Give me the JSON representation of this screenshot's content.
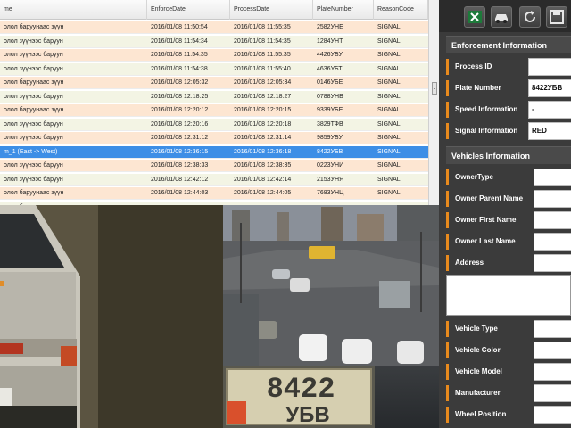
{
  "table": {
    "columns": [
      {
        "label": "me"
      },
      {
        "label": "EnforceDate"
      },
      {
        "label": "ProcessDate"
      },
      {
        "label": "PlateNumber"
      },
      {
        "label": "ReasonCode"
      }
    ],
    "rows": [
      {
        "name": "олол баруунаас зүүн",
        "enforce": "2016/01/08 11:50:54",
        "process": "2016/01/08 11:55:35",
        "plate": "2582УНЕ",
        "reason": "SIGNAL"
      },
      {
        "name": "олол зүүнээс баруун",
        "enforce": "2016/01/08 11:54:34",
        "process": "2016/01/08 11:54:35",
        "plate": "1284УНТ",
        "reason": "SIGNAL"
      },
      {
        "name": "олол зүүнээс баруун",
        "enforce": "2016/01/08 11:54:35",
        "process": "2016/01/08 11:55:35",
        "plate": "4426УБУ",
        "reason": "SIGNAL"
      },
      {
        "name": "олол зүүнээс баруун",
        "enforce": "2016/01/08 11:54:38",
        "process": "2016/01/08 11:55:40",
        "plate": "4636УБТ",
        "reason": "SIGNAL"
      },
      {
        "name": "олол баруунаас зүүн",
        "enforce": "2016/01/08 12:05:32",
        "process": "2016/01/08 12:05:34",
        "plate": "0146УБЕ",
        "reason": "SIGNAL"
      },
      {
        "name": "олол зүүнээс баруун",
        "enforce": "2016/01/08 12:18:25",
        "process": "2016/01/08 12:18:27",
        "plate": "0788УНВ",
        "reason": "SIGNAL"
      },
      {
        "name": "олол баруунаас зүүн",
        "enforce": "2016/01/08 12:20:12",
        "process": "2016/01/08 12:20:15",
        "plate": "9339УБЕ",
        "reason": "SIGNAL"
      },
      {
        "name": "олол зүүнээс баруун",
        "enforce": "2016/01/08 12:20:16",
        "process": "2016/01/08 12:20:18",
        "plate": "3829ТФВ",
        "reason": "SIGNAL"
      },
      {
        "name": "олол зүүнээс баруун",
        "enforce": "2016/01/08 12:31:12",
        "process": "2016/01/08 12:31:14",
        "plate": "9859УБУ",
        "reason": "SIGNAL"
      },
      {
        "name": "m_1 (East -> West)",
        "enforce": "2016/01/08 12:36:15",
        "process": "2016/01/08 12:36:18",
        "plate": "8422УБВ",
        "reason": "SIGNAL",
        "selected": true
      },
      {
        "name": "олол зүүнээс баруун",
        "enforce": "2016/01/08 12:38:33",
        "process": "2016/01/08 12:38:35",
        "plate": "0223УНИ",
        "reason": "SIGNAL"
      },
      {
        "name": "олол зүүнээс баруун",
        "enforce": "2016/01/08 12:42:12",
        "process": "2016/01/08 12:42:14",
        "plate": "2153УНЯ",
        "reason": "SIGNAL"
      },
      {
        "name": "олол баруунаас зүүн",
        "enforce": "2016/01/08 12:44:03",
        "process": "2016/01/08 12:44:05",
        "plate": "7683УНЦ",
        "reason": "SIGNAL"
      },
      {
        "name": "олол баруунаас зүүн",
        "enforce": "",
        "process": "",
        "plate": "",
        "reason": ""
      }
    ]
  },
  "toolbar": {
    "icons": [
      "excel-icon",
      "car-icon",
      "refresh-icon",
      "save-icon"
    ]
  },
  "enforcement": {
    "title": "Enforcement Information",
    "fields": [
      {
        "label": "Process ID",
        "value": ""
      },
      {
        "label": "Plate Number",
        "value": "8422УБВ"
      },
      {
        "label": "Speed Information",
        "value": "-"
      },
      {
        "label": "Signal Information",
        "value": "RED"
      }
    ]
  },
  "vehicles": {
    "title": "Vehicles Information",
    "owner_fields": [
      {
        "label": "OwnerType",
        "value": ""
      },
      {
        "label": "Owner Parent Name",
        "value": ""
      },
      {
        "label": "Owner First Name",
        "value": ""
      },
      {
        "label": "Owner Last Name",
        "value": ""
      },
      {
        "label": "Address",
        "value": ""
      }
    ],
    "vehicle_fields": [
      {
        "label": "Vehicle Type",
        "value": ""
      },
      {
        "label": "Vehicle Color",
        "value": ""
      },
      {
        "label": "Vehicle Model",
        "value": ""
      },
      {
        "label": "Manufacturer",
        "value": ""
      },
      {
        "label": "Wheel Position",
        "value": ""
      }
    ]
  },
  "plate_image": {
    "line1": "8422",
    "line2": "УБВ"
  },
  "colors": {
    "selected_row": "#3d8ee6",
    "row_even": "#fde6d2",
    "row_odd": "#f3f4e4",
    "field_accent": "#e88a1d"
  }
}
